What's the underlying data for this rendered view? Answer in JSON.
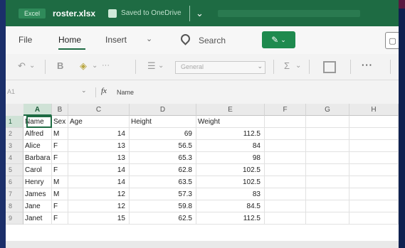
{
  "titlebar": {
    "badge": "Excel",
    "filename": "roster.xlsx",
    "saved_text": "Saved to OneDrive"
  },
  "ribbon": {
    "tabs": [
      {
        "label": "File"
      },
      {
        "label": "Home",
        "active": true
      },
      {
        "label": "Insert"
      }
    ],
    "search_label": "Search",
    "editing_glyph": "✎",
    "comments_glyph": "▢",
    "number_format": "General"
  },
  "formula_bar": {
    "name_box": "A1",
    "fx": "fx",
    "value": "Name"
  },
  "grid": {
    "columns": [
      "A",
      "B",
      "C",
      "D",
      "E",
      "F",
      "G",
      "H"
    ],
    "selected_column": "A",
    "header_row": [
      "Name",
      "Sex",
      "Age",
      "Height",
      "Weight"
    ],
    "rows": [
      {
        "num": "2",
        "name": "Alfred",
        "sex": "M",
        "age": "14",
        "height": "69",
        "weight": "112.5"
      },
      {
        "num": "3",
        "name": "Alice",
        "sex": "F",
        "age": "13",
        "height": "56.5",
        "weight": "84"
      },
      {
        "num": "4",
        "name": "Barbara",
        "sex": "F",
        "age": "13",
        "height": "65.3",
        "weight": "98"
      },
      {
        "num": "5",
        "name": "Carol",
        "sex": "F",
        "age": "14",
        "height": "62.8",
        "weight": "102.5"
      },
      {
        "num": "6",
        "name": "Henry",
        "sex": "M",
        "age": "14",
        "height": "63.5",
        "weight": "102.5"
      },
      {
        "num": "7",
        "name": "James",
        "sex": "M",
        "age": "12",
        "height": "57.3",
        "weight": "83"
      },
      {
        "num": "8",
        "name": "Jane",
        "sex": "F",
        "age": "12",
        "height": "59.8",
        "weight": "84.5"
      },
      {
        "num": "9",
        "name": "Janet",
        "sex": "F",
        "age": "15",
        "height": "62.5",
        "weight": "112.5"
      }
    ]
  },
  "colors": {
    "brand": "#1e6b43",
    "accent": "#1e8a4e"
  }
}
